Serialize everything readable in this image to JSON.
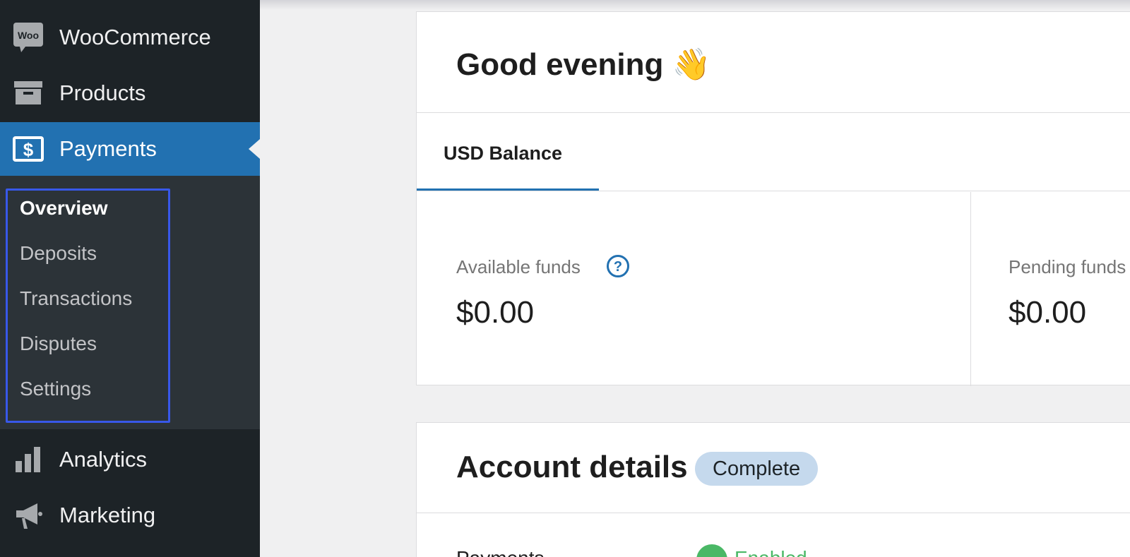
{
  "sidebar": {
    "items": [
      {
        "label": "WooCommerce",
        "icon": "woo-logo-icon"
      },
      {
        "label": "Products",
        "icon": "archive-box-icon"
      },
      {
        "label": "Payments",
        "icon": "dollar-card-icon",
        "active": true
      },
      {
        "label": "Analytics",
        "icon": "bar-chart-icon"
      },
      {
        "label": "Marketing",
        "icon": "megaphone-icon"
      }
    ],
    "woo_icon_text": "Woo",
    "submenu": [
      {
        "label": "Overview",
        "current": true
      },
      {
        "label": "Deposits"
      },
      {
        "label": "Transactions"
      },
      {
        "label": "Disputes"
      },
      {
        "label": "Settings"
      }
    ]
  },
  "overview": {
    "greeting": "Good evening 👋",
    "tab_label": "USD Balance",
    "available": {
      "label": "Available funds",
      "value": "$0.00"
    },
    "pending": {
      "label": "Pending funds",
      "value": "$0.00"
    }
  },
  "account": {
    "title": "Account details",
    "status_badge": "Complete",
    "rows": [
      {
        "label": "Payments",
        "status": "Enabled"
      }
    ]
  },
  "colors": {
    "sidebar_bg": "#1d2327",
    "active_blue": "#2271b1",
    "highlight_outline": "#3858e9",
    "badge_bg": "#c5d9ed",
    "enabled_green": "#4ab866"
  }
}
